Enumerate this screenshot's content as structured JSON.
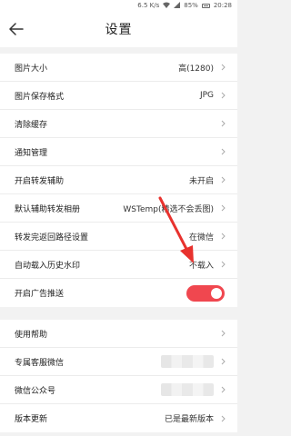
{
  "status_bar": {
    "speed": "6.5 K/s",
    "battery": "85%",
    "time": "20:28"
  },
  "header": {
    "title": "设置",
    "back_icon": "arrow-left-icon"
  },
  "section1": {
    "items": [
      {
        "label": "图片大小",
        "value": "高(1280)"
      },
      {
        "label": "图片保存格式",
        "value": "JPG"
      },
      {
        "label": "清除缓存",
        "value": ""
      },
      {
        "label": "通知管理",
        "value": ""
      },
      {
        "label": "开启转发辅助",
        "value": "未开启"
      },
      {
        "label": "默认辅助转发相册",
        "value": "WSTemp(精选不会丢图)"
      },
      {
        "label": "转发完返回路径设置",
        "value": "在微信"
      },
      {
        "label": "自动载入历史水印",
        "value": "不载入"
      },
      {
        "label": "开启广告推送",
        "value": "",
        "toggle_on": true
      }
    ]
  },
  "section2": {
    "items": [
      {
        "label": "使用帮助",
        "value": ""
      },
      {
        "label": "专属客服微信",
        "value": ""
      },
      {
        "label": "微信公众号",
        "value": ""
      },
      {
        "label": "版本更新",
        "value": "已是最新版本"
      }
    ]
  },
  "colors": {
    "toggle_on": "#f0474f",
    "annotation_arrow": "#e8322e"
  }
}
